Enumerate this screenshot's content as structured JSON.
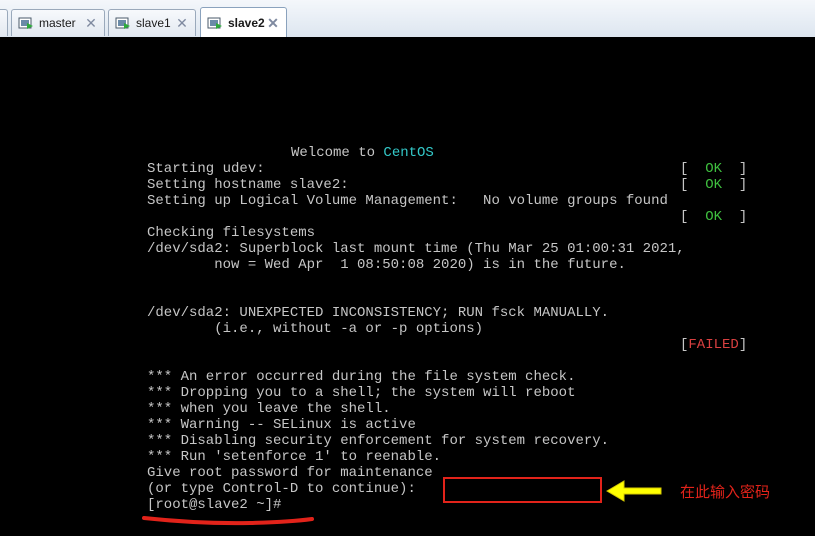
{
  "tabs": [
    {
      "label": "master",
      "close": "✕",
      "icon": "vm-icon",
      "active": false
    },
    {
      "label": "slave1",
      "close": "✕",
      "icon": "vm-icon",
      "active": false
    },
    {
      "label": "slave2",
      "close": "✕",
      "icon": "vm-icon",
      "active": true
    }
  ],
  "console": {
    "welcome_prefix": "Welcome to ",
    "welcome_os": "CentOS",
    "lines": [
      "Starting udev:",
      "Setting hostname slave2:",
      "Setting up Logical Volume Management:   No volume groups found",
      "Checking filesystems",
      "/dev/sda2: Superblock last mount time (Thu Mar 25 01:00:31 2021,",
      "        now = Wed Apr  1 08:50:08 2020) is in the future.",
      "/dev/sda2: UNEXPECTED INCONSISTENCY; RUN fsck MANUALLY.",
      "        (i.e., without -a or -p options)",
      "*** An error occurred during the file system check.",
      "*** Dropping you to a shell; the system will reboot",
      "*** when you leave the shell.",
      "*** Warning -- SELinux is active",
      "*** Disabling security enforcement for system recovery.",
      "*** Run 'setenforce 1' to reenable.",
      "Give root password for maintenance",
      "(or type Control-D to continue):",
      "[root@slave2 ~]#"
    ],
    "status_ok": {
      "open": "[  ",
      "word": "OK",
      "close": "  ]"
    },
    "status_failed": {
      "open": "[",
      "word": "FAILED",
      "close": "]"
    }
  },
  "annotation": {
    "text": "在此输入密码",
    "box_color": "#e2231a",
    "arrow_color": "#ffff00",
    "underline_color": "#e2231a"
  }
}
